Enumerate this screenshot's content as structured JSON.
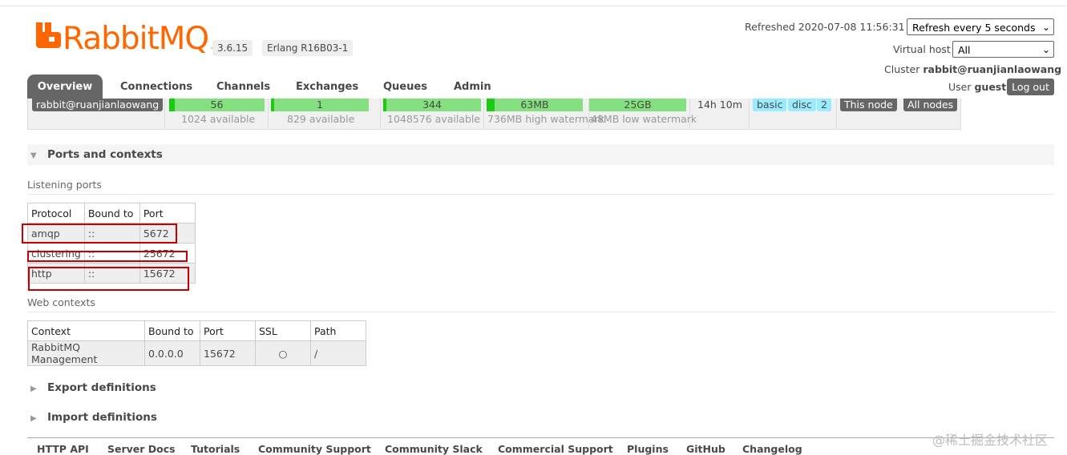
{
  "header": {
    "logo_text": "RabbitMQ",
    "logo_tm": "™",
    "version": "3.6.15",
    "erlang": "Erlang R16B03-1",
    "refreshed": "Refreshed 2020-07-08 11:56:31",
    "refresh_select": "Refresh every 5 seconds",
    "vhost_label": "Virtual host",
    "vhost_select": "All",
    "cluster_label": "Cluster",
    "cluster_name": "rabbit@ruanjianlaowang",
    "user_label": "User",
    "user_name": "guest",
    "logout": "Log out"
  },
  "tabs": [
    "Overview",
    "Connections",
    "Channels",
    "Exchanges",
    "Queues",
    "Admin"
  ],
  "node": {
    "name": "rabbit@ruanjianlaowang",
    "fd": {
      "value": "56",
      "sub": "1024 available",
      "fraction": 0.055
    },
    "sockets": {
      "value": "1",
      "sub": "829 available",
      "fraction": 0.0012
    },
    "procs": {
      "value": "344",
      "sub": "1048576 available",
      "fraction": 0.0003
    },
    "memory": {
      "value": "63MB",
      "sub": "736MB high watermark",
      "fraction": 0.086
    },
    "disk": {
      "value": "25GB",
      "sub": "48MB low watermark"
    },
    "uptime": "14h 10m",
    "info": [
      "basic",
      "disc",
      "2"
    ],
    "this_node": "This node",
    "all_nodes": "All nodes"
  },
  "ports_section": {
    "title": "Ports and contexts",
    "listening_label": "Listening ports",
    "listening_headers": [
      "Protocol",
      "Bound to",
      "Port"
    ],
    "listening_rows": [
      [
        "amqp",
        "::",
        "5672"
      ],
      [
        "clustering",
        "::",
        "25672"
      ],
      [
        "http",
        "::",
        "15672"
      ]
    ],
    "web_label": "Web contexts",
    "web_headers": [
      "Context",
      "Bound to",
      "Port",
      "SSL",
      "Path"
    ],
    "web_rows": [
      [
        "RabbitMQ Management",
        "0.0.0.0",
        "15672",
        "○",
        "/"
      ]
    ]
  },
  "export_title": "Export definitions",
  "import_title": "Import definitions",
  "footer": [
    "HTTP API",
    "Server Docs",
    "Tutorials",
    "Community Support",
    "Community Slack",
    "Commercial Support",
    "Plugins",
    "GitHub",
    "Changelog"
  ],
  "watermark": "@稀土掘金技术社区",
  "colors": {
    "brand": "#ff6600",
    "tab_active": "#666666",
    "gauge_green": "#84e07f",
    "tag_blue": "#99ebff",
    "highlight_red": "#c60000"
  },
  "icons": {
    "section_expanded": "triangle-down-icon",
    "section_collapsed": "triangle-right-icon",
    "select_arrow": "chevron-down-icon"
  }
}
